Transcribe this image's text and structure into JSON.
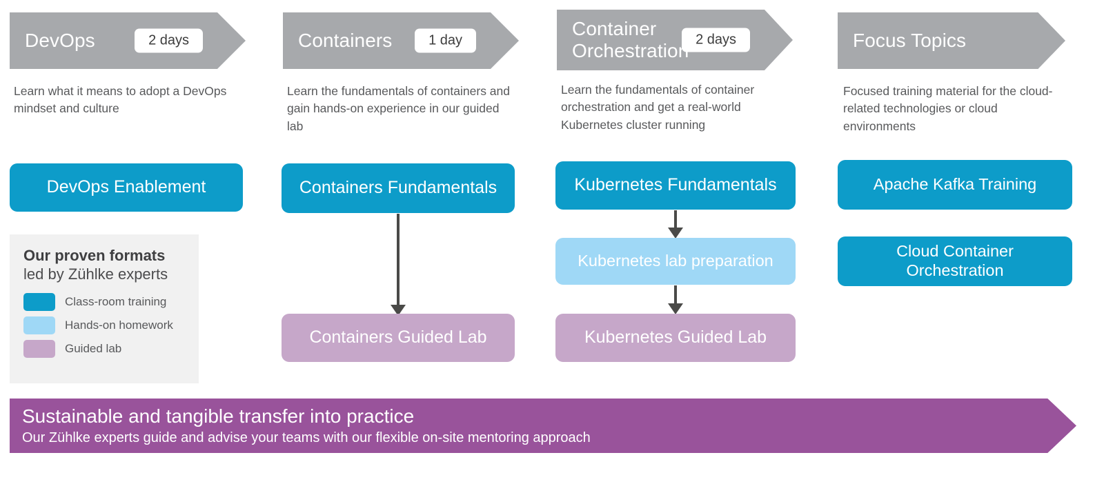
{
  "palette": {
    "header_gray": "#a7a9ac",
    "classroom_blue": "#0d9cc9",
    "homework_light_blue": "#9fd8f6",
    "guided_lab_lilac": "#c6a7c9",
    "banner_purple": "#99539b",
    "arrow_dark": "#4a4a48",
    "legend_bg": "#f1f1f1",
    "body_text": "#58595b"
  },
  "columns": [
    {
      "id": "devops",
      "header": {
        "title": "DevOps",
        "duration": "2 days",
        "has_duration": true
      },
      "description": "Learn what it means to adopt a DevOps mindset and culture",
      "boxes": [
        {
          "label": "DevOps Enablement",
          "format": "Class-room training"
        }
      ]
    },
    {
      "id": "containers",
      "header": {
        "title": "Containers",
        "duration": "1 day",
        "has_duration": true
      },
      "description": "Learn the fundamentals of containers and gain hands-on experience in our guided lab",
      "boxes": [
        {
          "label": "Containers Fundamentals",
          "format": "Class-room training"
        },
        {
          "label": "Containers Guided Lab",
          "format": "Guided lab"
        }
      ]
    },
    {
      "id": "container-orchestration",
      "header": {
        "title": "Container Orchestration",
        "duration": "2 days",
        "has_duration": true
      },
      "description": "Learn the fundamentals of container orchestration and get a real-world Kubernetes cluster running",
      "boxes": [
        {
          "label": "Kubernetes Fundamentals",
          "format": "Class-room training"
        },
        {
          "label": "Kubernetes lab preparation",
          "format": "Hands-on homework"
        },
        {
          "label": "Kubernetes Guided Lab",
          "format": "Guided lab"
        }
      ]
    },
    {
      "id": "focus-topics",
      "header": {
        "title": "Focus Topics",
        "duration": "",
        "has_duration": false
      },
      "description": "Focused training material for the cloud-related technologies or cloud environments",
      "boxes": [
        {
          "label": "Apache Kafka Training",
          "format": "Class-room training"
        },
        {
          "label": "Cloud Container Orchestration",
          "format": "Class-room training"
        }
      ]
    }
  ],
  "legend": {
    "title": "Our proven formats",
    "subtitle": "led by Zühlke experts",
    "items": [
      {
        "label": "Class-room training",
        "color": "#0d9cc9"
      },
      {
        "label": "Hands-on homework",
        "color": "#9fd8f6"
      },
      {
        "label": "Guided lab",
        "color": "#c6a7c9"
      }
    ]
  },
  "banner": {
    "title": "Sustainable and tangible transfer into practice",
    "subtitle": "Our Zühlke experts guide and advise your teams with our flexible on-site mentoring approach"
  }
}
